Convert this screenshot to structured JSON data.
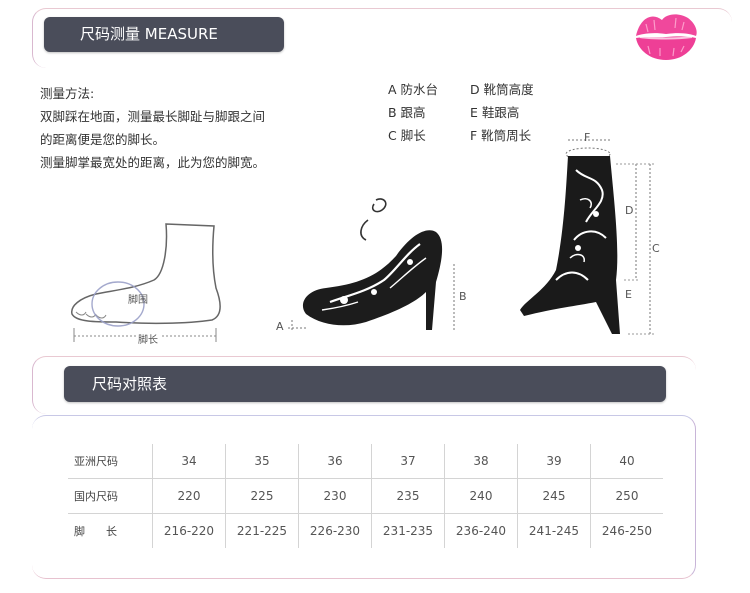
{
  "header": {
    "title": "尺码测量   MEASURE"
  },
  "method": {
    "heading": "测量方法:",
    "lines": [
      "双脚踩在地面，测量最长脚趾与脚跟之间",
      "的距离便是您的脚长。",
      "测量脚掌最宽处的距离，此为您的脚宽。"
    ]
  },
  "legend": {
    "left": [
      "A 防水台",
      "B 跟高",
      "C 脚长"
    ],
    "right": [
      "D 靴筒高度",
      "E 鞋跟高",
      "F 靴筒周长"
    ]
  },
  "illustrations": {
    "foot": {
      "girth_label": "脚围",
      "length_label": "脚长"
    },
    "pump": {
      "a": "A",
      "b": "B"
    },
    "boot": {
      "f": "F",
      "d": "D",
      "c": "C",
      "e": "E"
    }
  },
  "size_chart": {
    "title": "尺码对照表",
    "rows": [
      {
        "label": "亚洲尺码",
        "values": [
          "34",
          "35",
          "36",
          "37",
          "38",
          "39",
          "40"
        ]
      },
      {
        "label": "国内尺码",
        "values": [
          "220",
          "225",
          "230",
          "235",
          "240",
          "245",
          "250"
        ]
      },
      {
        "label": "脚      长",
        "values": [
          "216-220",
          "221-225",
          "226-230",
          "231-235",
          "236-240",
          "241-245",
          "246-250"
        ]
      }
    ]
  },
  "colors": {
    "banner": "#4a4d5a",
    "lips": "#f0489c",
    "frame": "#e0c3d0"
  }
}
